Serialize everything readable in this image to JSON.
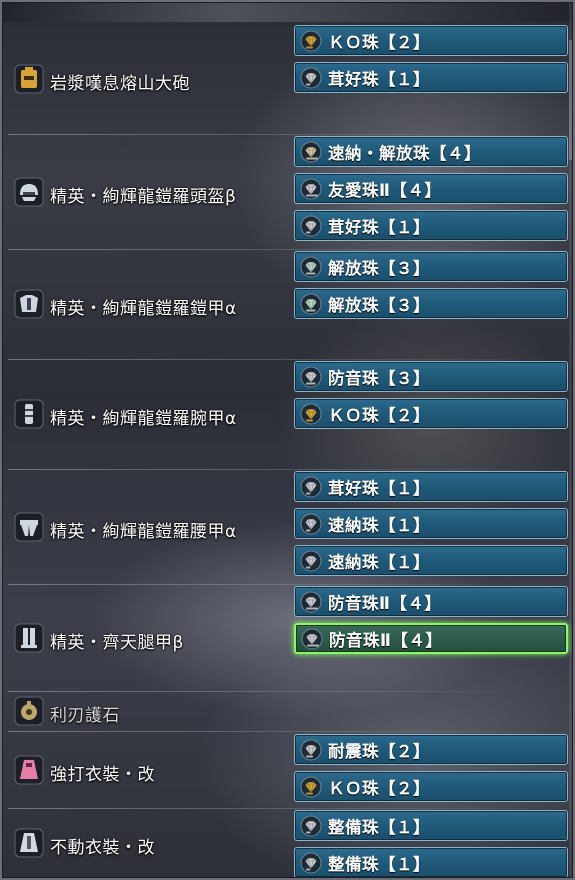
{
  "colors": {
    "slot_fill": "#1f5878",
    "slot_border": "#8fb3c6",
    "selected_border": "#8ef56a",
    "jewel_gold": "#d4a63a",
    "jewel_silver": "#c9ccd2"
  },
  "equipment": [
    {
      "name": "岩漿嘆息熔山大砲",
      "icon": "great-cannon-weapon-icon",
      "icon_color": "#d9a437",
      "slots": [
        {
          "label": "ＫＯ珠【２】",
          "icon": "jewel-lv2-icon",
          "color": "#d4a63a"
        },
        {
          "label": "茸好珠【１】",
          "icon": "jewel-lv1-icon",
          "color": "#c9ccd2"
        }
      ]
    },
    {
      "name": "精英・絢輝龍鎧羅頭盔β",
      "icon": "helm-armor-icon",
      "icon_color": "#cfd6df",
      "slots": [
        {
          "label": "速納・解放珠【４】",
          "icon": "jewel-lv4-icon",
          "color": "#d4c8a0"
        },
        {
          "label": "友愛珠Ⅱ【４】",
          "icon": "jewel-lv4-icon",
          "color": "#c9ccd2"
        },
        {
          "label": "茸好珠【１】",
          "icon": "jewel-lv1-icon",
          "color": "#c9ccd2"
        }
      ]
    },
    {
      "name": "精英・絢輝龍鎧羅鎧甲α",
      "icon": "chest-armor-icon",
      "icon_color": "#cfd6df",
      "slots": [
        {
          "label": "解放珠【３】",
          "icon": "jewel-lv3-icon",
          "color": "#b9d7c8"
        },
        {
          "label": "解放珠【３】",
          "icon": "jewel-lv3-icon",
          "color": "#b9d7c8"
        }
      ]
    },
    {
      "name": "精英・絢輝龍鎧羅腕甲α",
      "icon": "arm-armor-icon",
      "icon_color": "#cfd6df",
      "slots": [
        {
          "label": "防音珠【３】",
          "icon": "jewel-lv3-icon",
          "color": "#c9ccd2"
        },
        {
          "label": "ＫＯ珠【２】",
          "icon": "jewel-lv2-icon",
          "color": "#d4a63a"
        }
      ]
    },
    {
      "name": "精英・絢輝龍鎧羅腰甲α",
      "icon": "waist-armor-icon",
      "icon_color": "#cfd6df",
      "slots": [
        {
          "label": "茸好珠【１】",
          "icon": "jewel-lv1-icon",
          "color": "#c9ccd2"
        },
        {
          "label": "速納珠【１】",
          "icon": "jewel-lv1-icon",
          "color": "#c9ccd2"
        },
        {
          "label": "速納珠【１】",
          "icon": "jewel-lv1-icon",
          "color": "#c9ccd2"
        }
      ]
    },
    {
      "name": "精英・齊天腿甲β",
      "icon": "leg-armor-icon",
      "icon_color": "#cfd6df",
      "slots": [
        {
          "label": "防音珠Ⅱ【４】",
          "icon": "jewel-lv4-icon",
          "color": "#c9ccd2"
        },
        {
          "label": "防音珠Ⅱ【４】",
          "icon": "jewel-lv4-icon",
          "color": "#c9ccd2",
          "selected": true
        }
      ]
    },
    {
      "name": "利刃護石",
      "icon": "charm-icon",
      "icon_color": "#b8a66a",
      "dim": true,
      "slots": []
    },
    {
      "name": "強打衣裝・改",
      "icon": "power-mantle-icon",
      "icon_color": "#e37fa6",
      "slots": [
        {
          "label": "耐震珠【２】",
          "icon": "jewel-lv2-icon",
          "color": "#c9ccd2"
        },
        {
          "label": "ＫＯ珠【２】",
          "icon": "jewel-lv2-icon",
          "color": "#d4a63a"
        }
      ]
    },
    {
      "name": "不動衣裝・改",
      "icon": "immovable-mantle-icon",
      "icon_color": "#d5d8de",
      "slots": [
        {
          "label": "整備珠【１】",
          "icon": "jewel-lv1-icon",
          "color": "#c9ccd2"
        },
        {
          "label": "整備珠【１】",
          "icon": "jewel-lv1-icon",
          "color": "#c9ccd2"
        }
      ]
    }
  ]
}
